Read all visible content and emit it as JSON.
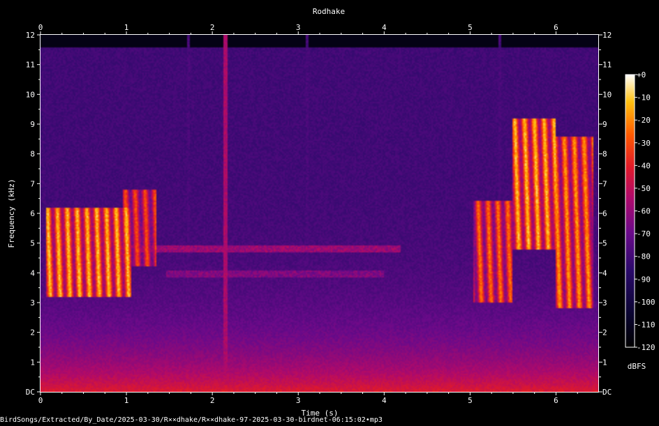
{
  "chart_data": {
    "type": "heatmap",
    "title": "Rodhake",
    "xlabel": "Time (s)",
    "ylabel": "Frequency (kHz)",
    "xlim": [
      0,
      6.5
    ],
    "ylim": [
      0,
      12
    ],
    "x_ticks": [
      "0",
      "1",
      "2",
      "3",
      "4",
      "5",
      "6"
    ],
    "y_ticks": [
      "DC",
      "1",
      "2",
      "3",
      "4",
      "5",
      "6",
      "7",
      "8",
      "9",
      "10",
      "11",
      "12"
    ],
    "colorbar": {
      "label": "dBFS",
      "ticks": [
        "+0",
        "-10",
        "-20",
        "-30",
        "-40",
        "-50",
        "-60",
        "-70",
        "-80",
        "-90",
        "-100",
        "-110",
        "-120"
      ],
      "range": [
        -120,
        0
      ]
    },
    "source_path": "BirdSongs/Extracted/By_Date/2025-03-30/R××dhake/R××dhake-97-2025-03-30-birdnet-06:15:02•mp3",
    "features": [
      {
        "kind": "burst",
        "t0": 0.05,
        "t1": 1.05,
        "f0": 3.2,
        "f1": 6.2,
        "level": 0.85
      },
      {
        "kind": "burst",
        "t0": 0.95,
        "t1": 1.35,
        "f0": 4.2,
        "f1": 6.8,
        "level": 0.7
      },
      {
        "kind": "burst",
        "t0": 5.05,
        "t1": 5.5,
        "f0": 3.0,
        "f1": 6.4,
        "level": 0.75
      },
      {
        "kind": "burst",
        "t0": 5.5,
        "t1": 6.0,
        "f0": 4.8,
        "f1": 9.2,
        "level": 0.85
      },
      {
        "kind": "burst",
        "t0": 6.0,
        "t1": 6.45,
        "f0": 2.8,
        "f1": 8.6,
        "level": 0.8
      },
      {
        "kind": "tone",
        "t0": 1.0,
        "t1": 4.2,
        "f": 4.8,
        "level": 0.45
      },
      {
        "kind": "tone",
        "t0": 1.45,
        "t1": 4.0,
        "f": 3.95,
        "level": 0.4
      },
      {
        "kind": "click",
        "t": 2.15,
        "level": 0.5
      },
      {
        "kind": "click",
        "t": 1.72,
        "level": 0.3
      },
      {
        "kind": "click",
        "t": 3.1,
        "level": 0.3
      },
      {
        "kind": "click",
        "t": 5.35,
        "level": 0.3
      }
    ],
    "colors": {
      "background": "#000000",
      "text": "#ffffff"
    }
  }
}
